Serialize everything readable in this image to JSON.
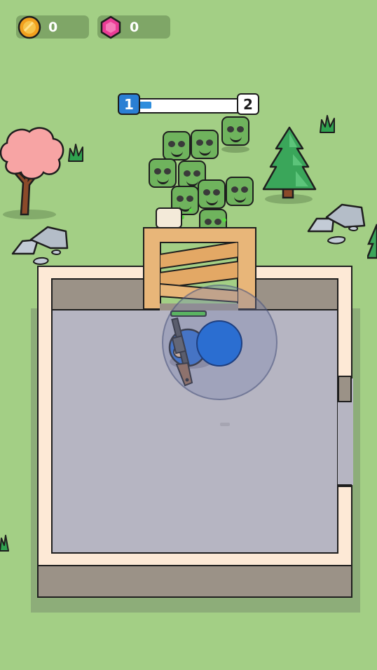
{
  "hud": {
    "coins": {
      "value": "0",
      "icon": "coin-icon",
      "color": "#f2a01e"
    },
    "gems": {
      "value": "0",
      "icon": "gem-icon",
      "color": "#ea3c96"
    }
  },
  "level_progress": {
    "current_level": "1",
    "next_level": "2",
    "fill_fraction": 0.17,
    "fill_color": "#2d8ddd"
  },
  "colors": {
    "grass": "#a3cf85",
    "floor": "#b6b5c2",
    "wall_top": "#fde9d6",
    "wall_side": "#9b9287",
    "door_wood": "#e8b679",
    "player_blue": "#2b6ed1",
    "joystick_knob": "#2b6ed1"
  },
  "scene": {
    "zombie_count": 12,
    "player_health_fraction": 1.0,
    "joystick_icon": "virtual-joystick",
    "weapon_icon": "rifle-icon"
  }
}
